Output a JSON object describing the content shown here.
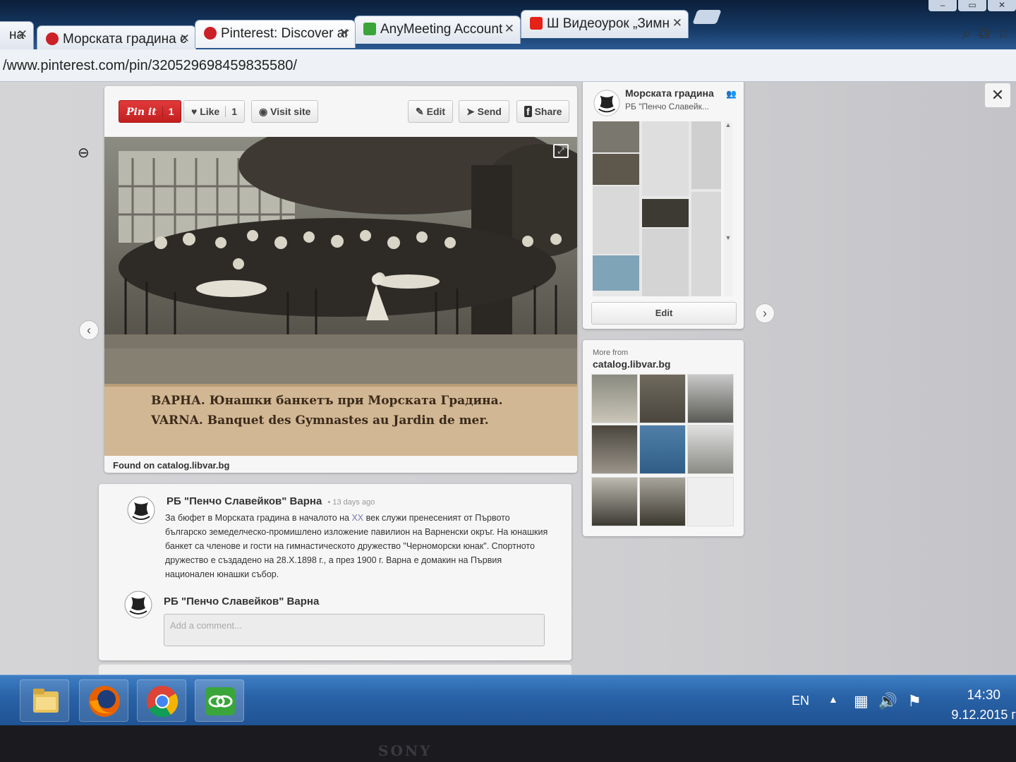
{
  "browser": {
    "tabs": [
      {
        "label": "на",
        "close": "✕",
        "favicon_color": "#ffffff"
      },
      {
        "label": "Морската градина с",
        "close": "✕",
        "favicon_color": "#cb2027"
      },
      {
        "label": "Pinterest: Discover ar",
        "close": "✕",
        "favicon_color": "#cb2027"
      },
      {
        "label": "AnyMeeting Account",
        "close": "✕",
        "favicon_color": "#3aa53a"
      },
      {
        "label": "Ш Видеоурок „Зимн",
        "close": "✕",
        "favicon_color": "#e62117"
      }
    ],
    "url": "/www.pinterest.com/pin/320529698459835580/",
    "toolbar_icons": [
      "search-icon",
      "translate-icon",
      "star-icon"
    ]
  },
  "overlay": {
    "close": "✕",
    "zoom_icon": "⊖"
  },
  "pin": {
    "pin_it_label": "Pin it",
    "pin_it_count": "1",
    "like_label": "Like",
    "like_count": "1",
    "visit_label": "Visit site",
    "edit_label": "Edit",
    "send_label": "Send",
    "share_label": "Share",
    "caption_line1": "ВАРНА. Юнашки банкетъ при Морската Градина.",
    "caption_line2": "VARNA. Banquet des Gymnastes au Jardin de mer.",
    "found_on": "Found on catalog.libvar.bg"
  },
  "description": {
    "author": "РБ \"Пенчо Славейков\" Варна",
    "time": "• 13 days ago",
    "text_before": "За бюфет в Морската градина в началото на ",
    "text_highlight": "XX",
    "text_after": " век служи пренесеният от Първото българско земеделческо-промишлено изложение павилион на Варненски окръг. На юнашкия банкет са членове и гости на гимнастическото дружество \"Черноморски юнак\". Спортното дружество е създадено на 28.X.1898 г., а през 1900 г. Варна е домакин на Първия национален юнашки събор."
  },
  "comment": {
    "user": "РБ \"Пенчо Славейков\" Варна",
    "placeholder": "Add a comment..."
  },
  "board": {
    "name": "Морската градина",
    "owner": "РБ \"Пенчо Славейк...",
    "edit_label": "Edit"
  },
  "more_from": {
    "label": "More from",
    "domain": "catalog.libvar.bg"
  },
  "taskbar": {
    "apps": [
      "file-explorer-icon",
      "firefox-icon",
      "chrome-icon",
      "anymeeting-icon"
    ],
    "lang": "EN",
    "time": "14:30",
    "date": "9.12.2015 г"
  },
  "monitor_brand": "SONY",
  "colors": {
    "pinterest_red": "#cb2027",
    "sepia_photo": "#6b5a44",
    "taskbar_blue": "#2a63a8"
  }
}
